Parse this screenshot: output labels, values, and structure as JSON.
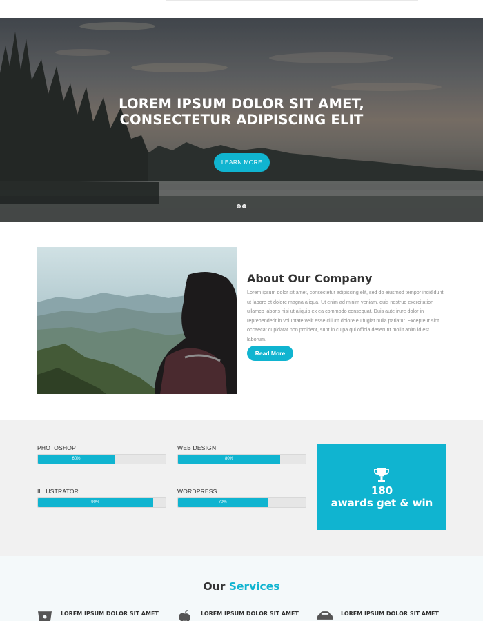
{
  "hero": {
    "title_line1": "LOREM IPSUM DOLOR SIT AMET,",
    "title_line2": "CONSECTETUR ADIPISCING ELIT",
    "button_label": "LEARN MORE",
    "slide_count": 2,
    "active_slide": 1
  },
  "about": {
    "title": "About Our Company",
    "body": "Lorem ipsum dolor sit amet, consectetur adipiscing elit, sed do eiusmod tempor incididunt ut labore et dolore magna aliqua. Ut enim ad minim veniam, quis nostrud exercitation ullamco laboris nisi ut aliquip ex ea commodo consequat. Duis aute irure dolor in reprehenderit in voluptate velit esse cillum dolore eu fugiat nulla pariatur. Excepteur sint occaecat cupidatat non proident, sunt in culpa qui officia deserunt mollit anim id est laborum.",
    "button_label": "Read More"
  },
  "skills": [
    {
      "name": "PHOTOSHOP",
      "percent": 60,
      "label": "60%"
    },
    {
      "name": "WEB DESIGN",
      "percent": 80,
      "label": "80%"
    },
    {
      "name": "ILLUSTRATOR",
      "percent": 90,
      "label": "90%"
    },
    {
      "name": "WORDPRESS",
      "percent": 70,
      "label": "70%"
    }
  ],
  "award": {
    "icon": "trophy-icon",
    "number": "180",
    "text": "awards get & win"
  },
  "services": {
    "title_main": "Our",
    "title_accent": "Services",
    "items": [
      {
        "icon": "bucket-icon",
        "label": "LOREM IPSUM DOLOR SIT AMET"
      },
      {
        "icon": "apple-icon",
        "label": "LOREM IPSUM DOLOR SIT AMET"
      },
      {
        "icon": "car-icon",
        "label": "LOREM IPSUM DOLOR SIT AMET"
      }
    ]
  },
  "colors": {
    "accent": "#10b4d0",
    "skills_bg": "#f1f1f1",
    "services_bg": "#f4f9fa"
  }
}
